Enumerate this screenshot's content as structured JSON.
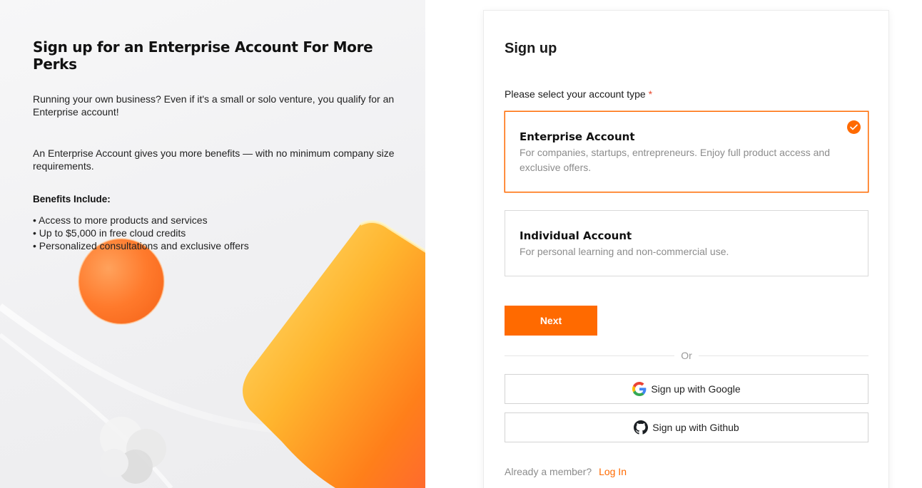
{
  "promo": {
    "title": "Sign up for an Enterprise Account For More Perks",
    "paragraph1": "Running your own business? Even if it's a small or solo venture, you qualify for an Enterprise account!",
    "paragraph2": "An Enterprise Account gives you more benefits — with no minimum company size requirements.",
    "benefits_heading": "Benefits Include:",
    "benefits": [
      "• Access to more products and services",
      "• Up to $5,000 in free cloud credits",
      "• Personalized consultations and exclusive offers"
    ]
  },
  "form": {
    "title": "Sign up",
    "account_type_label": "Please select your account type",
    "required_mark": "*",
    "options": [
      {
        "title": "Enterprise Account",
        "description": "For companies, startups, entrepreneurs. Enjoy full product access and exclusive offers.",
        "selected": true
      },
      {
        "title": "Individual Account",
        "description": "For personal learning and non-commercial use.",
        "selected": false
      }
    ],
    "next_label": "Next",
    "divider_text": "Or",
    "google_label": "Sign up with Google",
    "github_label": "Sign up with Github",
    "member_prompt": "Already a member?",
    "login_label": "Log In"
  },
  "colors": {
    "accent": "#ff6a00",
    "required": "#e8472b",
    "muted_text": "#8c8c8c"
  },
  "icons": {
    "selected_check": "check-icon",
    "google": "google-icon",
    "github": "github-icon"
  }
}
